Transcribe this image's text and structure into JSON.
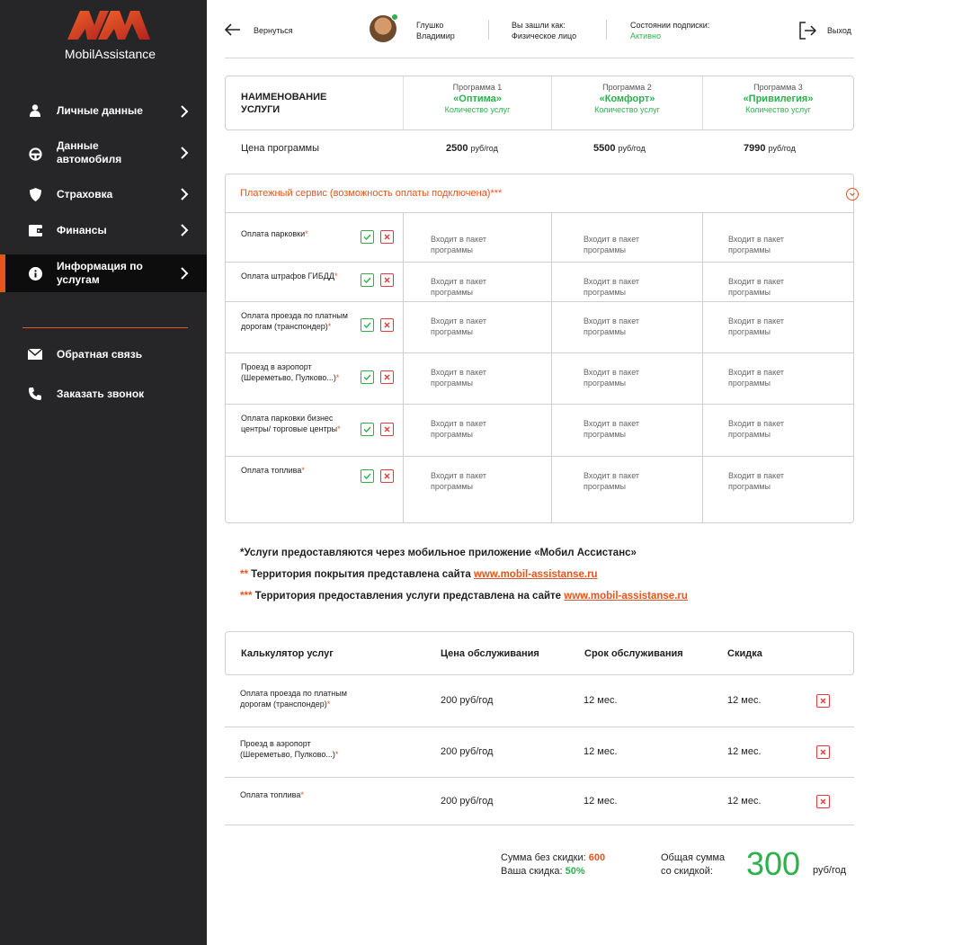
{
  "brand": {
    "name": "MobilAssistance",
    "accent": "#e8541d",
    "green": "#2bb24c"
  },
  "sidebar": {
    "items": [
      {
        "label": "Личные данные",
        "icon": "user-icon"
      },
      {
        "label": "Данные автомобиля",
        "icon": "steering-wheel-icon"
      },
      {
        "label": "Страховка",
        "icon": "shield-icon"
      },
      {
        "label": "Финансы",
        "icon": "wallet-icon"
      },
      {
        "label": "Информация по услугам",
        "icon": "info-icon",
        "active": true
      }
    ],
    "extra": [
      {
        "label": "Обратная связь",
        "icon": "envelope-icon"
      },
      {
        "label": "Заказать звонок",
        "icon": "phone-icon"
      }
    ]
  },
  "header": {
    "back": "Вернуться",
    "user_first": "Глушко",
    "user_last": "Владимир",
    "login_as_label": "Вы зашли как:",
    "login_as_value": "Физическое лицо",
    "sub_label": "Состоянии подписки:",
    "sub_value": "Активно",
    "exit": "Выход"
  },
  "programs": {
    "title": "НАИМЕНОВАНИЕ УСЛУГИ",
    "items": [
      {
        "num": "Программа 1",
        "name": "«Оптима»",
        "count": "Количество услуг",
        "price": "2500",
        "unit": "руб/год"
      },
      {
        "num": "Программа 2",
        "name": "«Комфорт»",
        "count": "Количество услуг",
        "price": "5500",
        "unit": "руб/год"
      },
      {
        "num": "Программа 3",
        "name": "«Привилегия»",
        "count": "Количество услуг",
        "price": "7990",
        "unit": "руб/год"
      }
    ],
    "price_label": "Цена программы"
  },
  "payment": {
    "title": "Платежный сервис (возможность оплаты подключена)***",
    "included": "Входит в пакет программы",
    "rows": [
      {
        "name": "Оплата парковки"
      },
      {
        "name": "Оплата штрафов ГИБДД"
      },
      {
        "name": "Оплата проезда по платным дорогам (транспондер)"
      },
      {
        "name": "Проезд в аэропорт (Шереметьво, Пулково...)"
      },
      {
        "name": "Оплата парковки бизнес центры/ торговые центры"
      },
      {
        "name": "Оплата топлива"
      }
    ]
  },
  "notes": {
    "n1": "*Услуги предоставляются через мобильное приложение «Мобил Ассистанс»",
    "n2_star": "**",
    "n2": " Территория покрытия представлена сайта ",
    "n3_star": "***",
    "n3": " Территория предоставления услуги представлена на сайте ",
    "link": "www.mobil-assistanse.ru"
  },
  "calculator": {
    "title": "Калькулятор услуг",
    "col_price": "Цена обслуживания",
    "col_term": "Срок обслуживания",
    "col_discount": "Скидка",
    "rows": [
      {
        "name": "Оплата проезда по платным дорогам (транспондер)",
        "price": "200 руб/год",
        "term": "12 мес.",
        "discount": "12 мес."
      },
      {
        "name": "Проезд в аэропорт (Шереметьво, Пулково...)",
        "price": "200 руб/год",
        "term": "12 мес.",
        "discount": "12 мес."
      },
      {
        "name": "Оплата топлива",
        "price": "200 руб/год",
        "term": "12 мес.",
        "discount": "12 мес."
      }
    ],
    "sum_label": "Сумма без скидки:",
    "sum_value": "600",
    "discount_label": "Ваша скидка:",
    "discount_value": "50%",
    "total_label_1": "Общая сумма",
    "total_label_2": "со скидкой:",
    "total_value": "300",
    "total_unit": "руб/год"
  }
}
